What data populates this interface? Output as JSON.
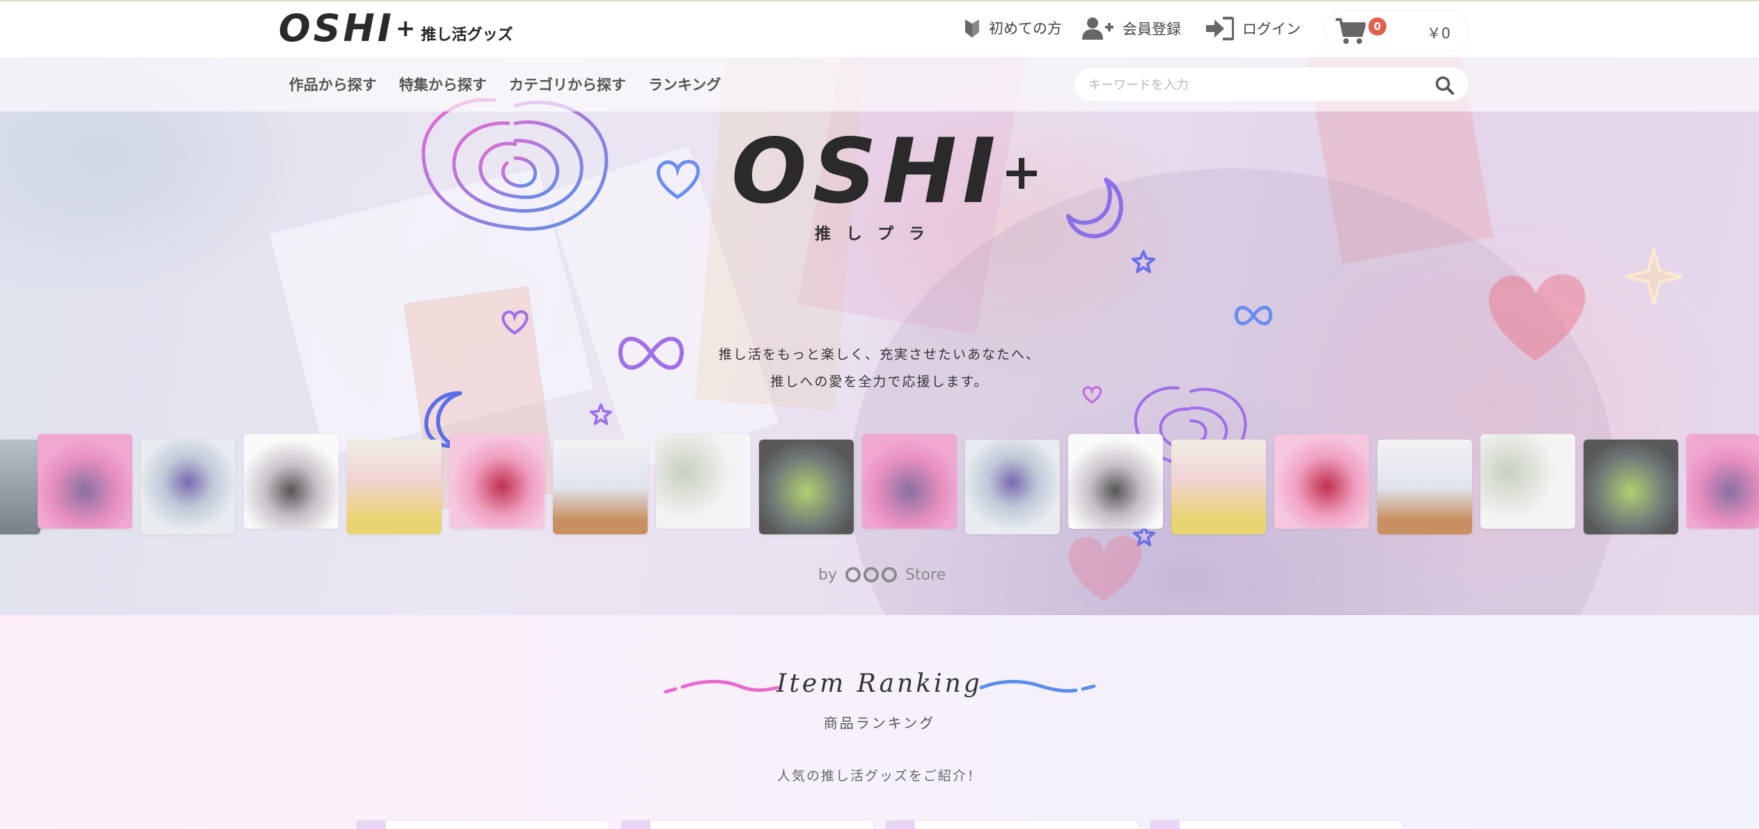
{
  "header": {
    "logo_mark": "OSHI",
    "logo_plus": "+",
    "logo_sub": "推し活グッズ",
    "nav": {
      "first_time": "初めての方",
      "register": "会員登録",
      "login": "ログイン"
    },
    "cart": {
      "count": "0",
      "total": "￥0"
    }
  },
  "category_nav": {
    "items": [
      "作品から探す",
      "特集から探す",
      "カテゴリから探す",
      "ランキング"
    ],
    "search_placeholder": "キーワードを入力"
  },
  "hero": {
    "brand_mark": "OSHI",
    "brand_plus": "+",
    "brand_sub": "推しプラ",
    "tagline_line1": "推し活をもっと楽しく、充実させたいあなたへ、",
    "tagline_line2": "推しへの愛を全力で応援します。",
    "by_prefix": "by",
    "by_store": "Store"
  },
  "ranking": {
    "title": "Item Ranking",
    "subtitle": "商品ランキング",
    "description": "人気の推し活グッズをご紹介！"
  },
  "colors": {
    "accent_pink": "#e86ad0",
    "accent_blue": "#5b8ee8",
    "accent_purple": "#a070e8",
    "badge_red": "#e0604c"
  }
}
